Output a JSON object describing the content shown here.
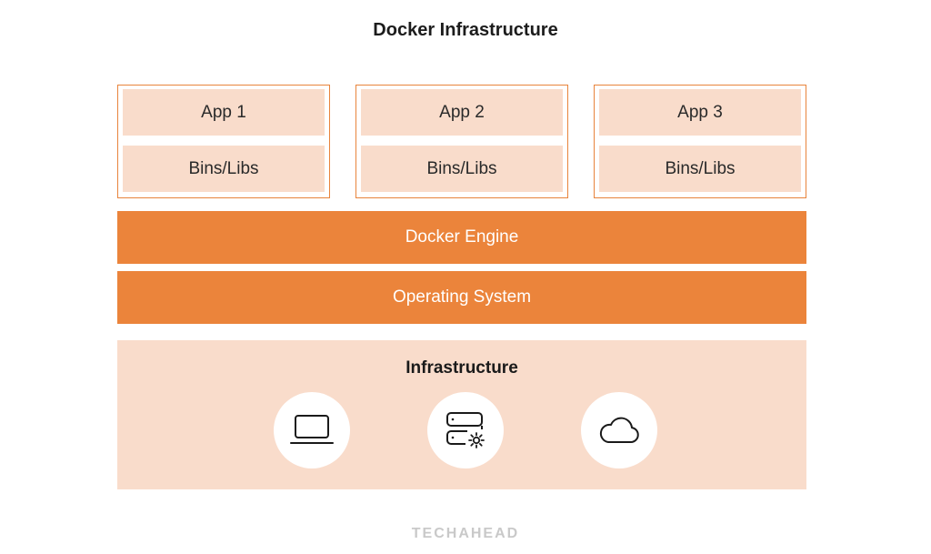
{
  "title": "Docker Infrastructure",
  "containers": [
    {
      "app": "App 1",
      "bins": "Bins/Libs"
    },
    {
      "app": "App 2",
      "bins": "Bins/Libs"
    },
    {
      "app": "App 3",
      "bins": "Bins/Libs"
    }
  ],
  "layers": {
    "engine": "Docker Engine",
    "os": "Operating System"
  },
  "infrastructure": {
    "title": "Infrastructure",
    "icons": [
      "laptop-icon",
      "server-settings-icon",
      "cloud-icon"
    ]
  },
  "footer": {
    "brand": "TECHAHEAD"
  },
  "colors": {
    "accent": "#eb843b",
    "light": "#f9dccb",
    "border": "#e8843c"
  }
}
